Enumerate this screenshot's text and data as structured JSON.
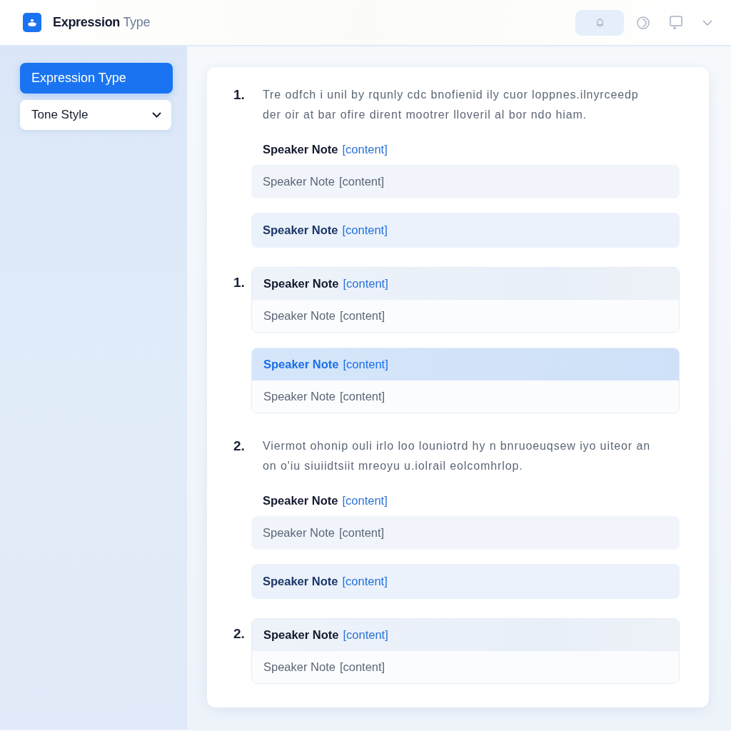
{
  "header": {
    "title": "**Expression** Type"
  },
  "sidebar": {
    "items": [
      {
        "label": "Expression Type",
        "kind": "item",
        "selected": true
      },
      {
        "label": "Tone Style",
        "kind": "dropdown",
        "selected": false
      }
    ]
  },
  "sections": [
    {
      "number": "1.",
      "kind": "paragraph",
      "text": "Tre odfch i unil by rqunly cdc bnofienid ily cuor loppnes.ilnyrceedp der oir at bar ofire dirent mootrer lloveril al bor ndo hiam.",
      "notes": [
        {
          "kind": "heading",
          "label": "Speaker Note",
          "tag": "[content]"
        },
        {
          "kind": "plain",
          "label": "Speaker Note",
          "tag": "[content]"
        },
        {
          "kind": "emphasis",
          "label": "Speaker Note",
          "tag": "[content]"
        }
      ]
    },
    {
      "number": "1.",
      "kind": "group",
      "cards": [
        {
          "selected": false,
          "header": {
            "label": "Speaker Note",
            "tag": "[content]"
          },
          "body": {
            "label": "Speaker Note",
            "tag": "[content]"
          }
        },
        {
          "selected": true,
          "header": {
            "label": "Speaker Note",
            "tag": "[content]"
          },
          "body": {
            "label": "Speaker Note",
            "tag": "[content]"
          }
        }
      ]
    },
    {
      "number": "2.",
      "kind": "paragraph",
      "text": "Viermot ohonip ouli irlo loo louniotrd hy n bnruoeuqsew iyo uiteor an on o'iu siuiidtsiit mreoyu u.iolrail eolcomhrlop.",
      "notes": [
        {
          "kind": "heading",
          "label": "Speaker Note",
          "tag": "[content]"
        },
        {
          "kind": "plain",
          "label": "Speaker Note",
          "tag": "[content]"
        },
        {
          "kind": "emphasis",
          "label": "Speaker Note",
          "tag": "[content]"
        }
      ]
    },
    {
      "number": "2.",
      "kind": "group",
      "cards": [
        {
          "selected": false,
          "header": {
            "label": "Speaker Note",
            "tag": "[content]"
          },
          "body": {
            "label": "Speaker Note",
            "tag": "[content]"
          }
        }
      ]
    }
  ]
}
